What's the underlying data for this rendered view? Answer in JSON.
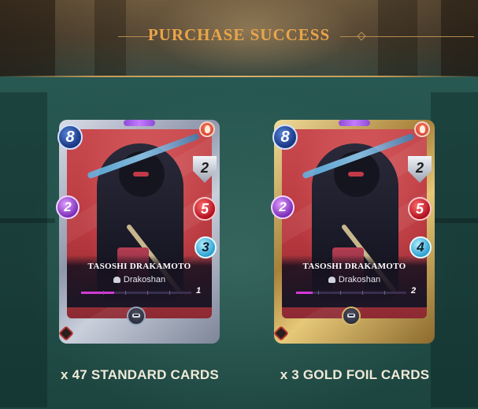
{
  "header": {
    "title": "PURCHASE SUCCESS"
  },
  "cards": [
    {
      "variant": "standard",
      "name": "TASOSHI DRAKAMOTO",
      "faction": "Drakoshan",
      "mana": "8",
      "magic": "2",
      "armor": "2",
      "health": "5",
      "speed": "3",
      "level": "1",
      "xp_progress": 0.3,
      "element_icon": "fire-icon",
      "ability_icon": "mask-icon",
      "caption": "x 47 STANDARD CARDS"
    },
    {
      "variant": "gold",
      "name": "TASOSHI DRAKAMOTO",
      "faction": "Drakoshan",
      "mana": "8",
      "magic": "2",
      "armor": "2",
      "health": "5",
      "speed": "4",
      "level": "2",
      "xp_progress": 0.15,
      "element_icon": "fire-icon",
      "ability_icon": "mask-icon",
      "caption": "x 3 GOLD FOIL CARDS"
    }
  ],
  "colors": {
    "title": "#e9a54a",
    "background": "#23504a",
    "xp_bar": "#d23ad6"
  }
}
